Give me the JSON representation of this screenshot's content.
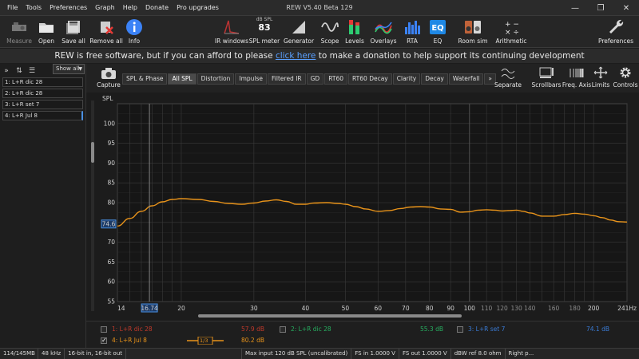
{
  "window": {
    "title": "REW V5.40 Beta 129",
    "menu": [
      "File",
      "Tools",
      "Preferences",
      "Graph",
      "Help",
      "Donate",
      "Pro upgrades"
    ],
    "controls": {
      "minimize": "—",
      "maximize": "❐",
      "close": "✕"
    }
  },
  "toolbar": {
    "measure": "Measure",
    "open": "Open",
    "save_all": "Save all",
    "remove_all": "Remove all",
    "info": "Info",
    "ir_windows": "IR windows",
    "spl_meter": "SPL meter",
    "spl_unit": "dB SPL",
    "spl_value": "83",
    "generator": "Generator",
    "scope": "Scope",
    "levels": "Levels",
    "overlays": "Overlays",
    "rta": "RTA",
    "eq": "EQ",
    "room_sim": "Room sim",
    "arithmetic": "Arithmetic",
    "preferences": "Preferences"
  },
  "banner": {
    "before": "REW is free software, but if you can afford to please ",
    "link": "click here",
    "after": " to make a donation to help support its continuing development"
  },
  "left_panel": {
    "show_all": "Show all",
    "measurements": [
      {
        "label": "1: L+R dic 28",
        "selected": false
      },
      {
        "label": "2: L+R dic 28",
        "selected": false
      },
      {
        "label": "3: L+R set 7",
        "selected": false
      },
      {
        "label": "4: L+R Jul 8",
        "selected": true
      }
    ]
  },
  "graph_bar": {
    "capture": "Capture",
    "tabs": [
      "SPL & Phase",
      "All SPL",
      "Distortion",
      "Impulse",
      "Filtered IR",
      "GD",
      "RT60",
      "RT60 Decay",
      "Clarity",
      "Decay",
      "Waterfall",
      "»"
    ],
    "active_tab": "All SPL",
    "separate": "Separate",
    "scrollbars": "Scrollbars",
    "freq_axis": "Freq. Axis",
    "limits": "Limits",
    "controls": "Controls"
  },
  "graph": {
    "y_axis_label": "SPL",
    "cursor_freq": "16.74",
    "cursor_spl": "74.6",
    "line_color": "#e8931a",
    "grid_color": "#3a3a3a"
  },
  "chart_data": {
    "type": "line",
    "title": "",
    "xlabel": "",
    "ylabel": "SPL",
    "x_scale": "log",
    "xlim": [
      14,
      241
    ],
    "ylim": [
      55,
      105
    ],
    "y_ticks": [
      55,
      60,
      65,
      70,
      75,
      80,
      85,
      90,
      95,
      100
    ],
    "x_ticks_major": [
      {
        "v": 14,
        "label": "14"
      },
      {
        "v": 20,
        "label": "20"
      },
      {
        "v": 30,
        "label": "30"
      },
      {
        "v": 40,
        "label": "40"
      },
      {
        "v": 50,
        "label": "50"
      },
      {
        "v": 60,
        "label": "60"
      },
      {
        "v": 70,
        "label": "70"
      },
      {
        "v": 80,
        "label": "80"
      },
      {
        "v": 90,
        "label": "90"
      },
      {
        "v": 100,
        "label": "100"
      },
      {
        "v": 200,
        "label": "200"
      },
      {
        "v": 241,
        "label": "241Hz"
      }
    ],
    "x_ticks_minor": [
      {
        "v": 110,
        "label": "110"
      },
      {
        "v": 120,
        "label": "120"
      },
      {
        "v": 130,
        "label": "130"
      },
      {
        "v": 140,
        "label": "140"
      },
      {
        "v": 160,
        "label": "160"
      },
      {
        "v": 180,
        "label": "180"
      }
    ],
    "grid": true,
    "series": [
      {
        "name": "4: L+R Jul 8",
        "color": "#e8931a",
        "x": [
          14,
          15,
          16,
          17,
          18,
          19,
          20,
          22,
          24,
          26,
          28,
          30,
          32,
          34,
          36,
          38,
          40,
          42,
          45,
          48,
          50,
          53,
          56,
          60,
          64,
          68,
          72,
          76,
          80,
          85,
          90,
          95,
          100,
          105,
          110,
          115,
          120,
          125,
          130,
          135,
          140,
          150,
          160,
          170,
          180,
          190,
          200,
          210,
          220,
          230,
          241
        ],
        "y": [
          74.1,
          76.0,
          77.8,
          79.2,
          80.2,
          80.8,
          81.0,
          80.8,
          80.3,
          79.8,
          79.6,
          79.9,
          80.4,
          80.7,
          80.3,
          79.6,
          79.6,
          79.9,
          80.0,
          79.8,
          79.6,
          79.0,
          78.4,
          77.8,
          78.0,
          78.5,
          78.9,
          79.0,
          78.9,
          78.4,
          78.3,
          77.6,
          77.7,
          78.1,
          78.2,
          78.1,
          77.9,
          78.0,
          78.1,
          77.8,
          77.4,
          76.6,
          76.6,
          77.0,
          77.3,
          77.1,
          76.7,
          76.2,
          75.6,
          75.2,
          75.1
        ]
      }
    ]
  },
  "legend": {
    "items": [
      {
        "label": "1: L+R dic 28",
        "value": "57.9 dB",
        "color": "#c0392b",
        "checked": false
      },
      {
        "label": "2: L+R dic 28",
        "value": "55.3 dB",
        "color": "#27ae60",
        "checked": false
      },
      {
        "label": "3: L+R set 7",
        "value": "74.1 dB",
        "color": "#3a7bd5",
        "checked": false
      },
      {
        "label": "4: L+R Jul 8",
        "value": "80.2 dB",
        "color": "#e8931a",
        "checked": true
      }
    ],
    "smoothing": "1/3"
  },
  "status_bar": {
    "memory": "114/145MB",
    "sample_rate": "48 kHz",
    "bit_depth": "16-bit in, 16-bit out",
    "max_input": "Max input 120 dB SPL (uncalibrated)",
    "fs_in": "FS in 1.0000 V",
    "fs_out": "FS out 1.0000 V",
    "dbw_ref": "dBW ref 8.0 ohm",
    "right": "Right p..."
  }
}
